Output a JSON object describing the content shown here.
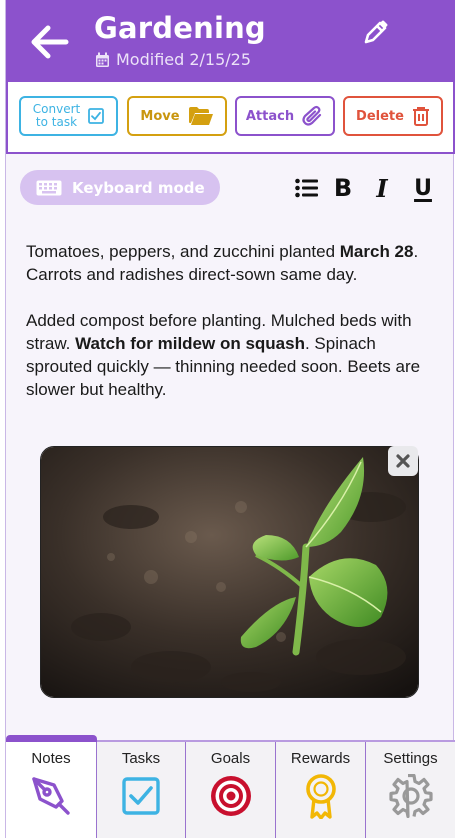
{
  "header": {
    "title": "Gardening",
    "modified": "Modified 2/15/25",
    "back_icon": "arrow-left-icon",
    "edit_icon": "pencil-icon",
    "calendar_icon": "calendar-icon"
  },
  "actions": {
    "convert_line1": "Convert",
    "convert_line2": "to task",
    "move": "Move",
    "attach": "Attach",
    "delete": "Delete"
  },
  "toolbar": {
    "keyboard_mode": "Keyboard mode",
    "bold": "B",
    "italic": "I",
    "underline": "U"
  },
  "note": {
    "p1_a": "Tomatoes, peppers, and zucchini planted ",
    "p1_b": "March 28",
    "p1_c": ". Carrots and radishes direct-sown same day.",
    "p2_a": "Added compost before planting. Mulched beds with straw. ",
    "p2_b": "Watch for mildew on squash",
    "p2_c": ". Spinach sprouted quickly — thinning needed soon. Beets are slower but healthy."
  },
  "nav": {
    "notes": "Notes",
    "tasks": "Tasks",
    "goals": "Goals",
    "rewards": "Rewards",
    "settings": "Settings",
    "active": "Notes"
  },
  "colors": {
    "brand": "#8c52cc",
    "convert": "#3db3e3",
    "move": "#d4a010",
    "delete": "#e0533c",
    "goals": "#c8102e",
    "rewards": "#f2b705"
  }
}
